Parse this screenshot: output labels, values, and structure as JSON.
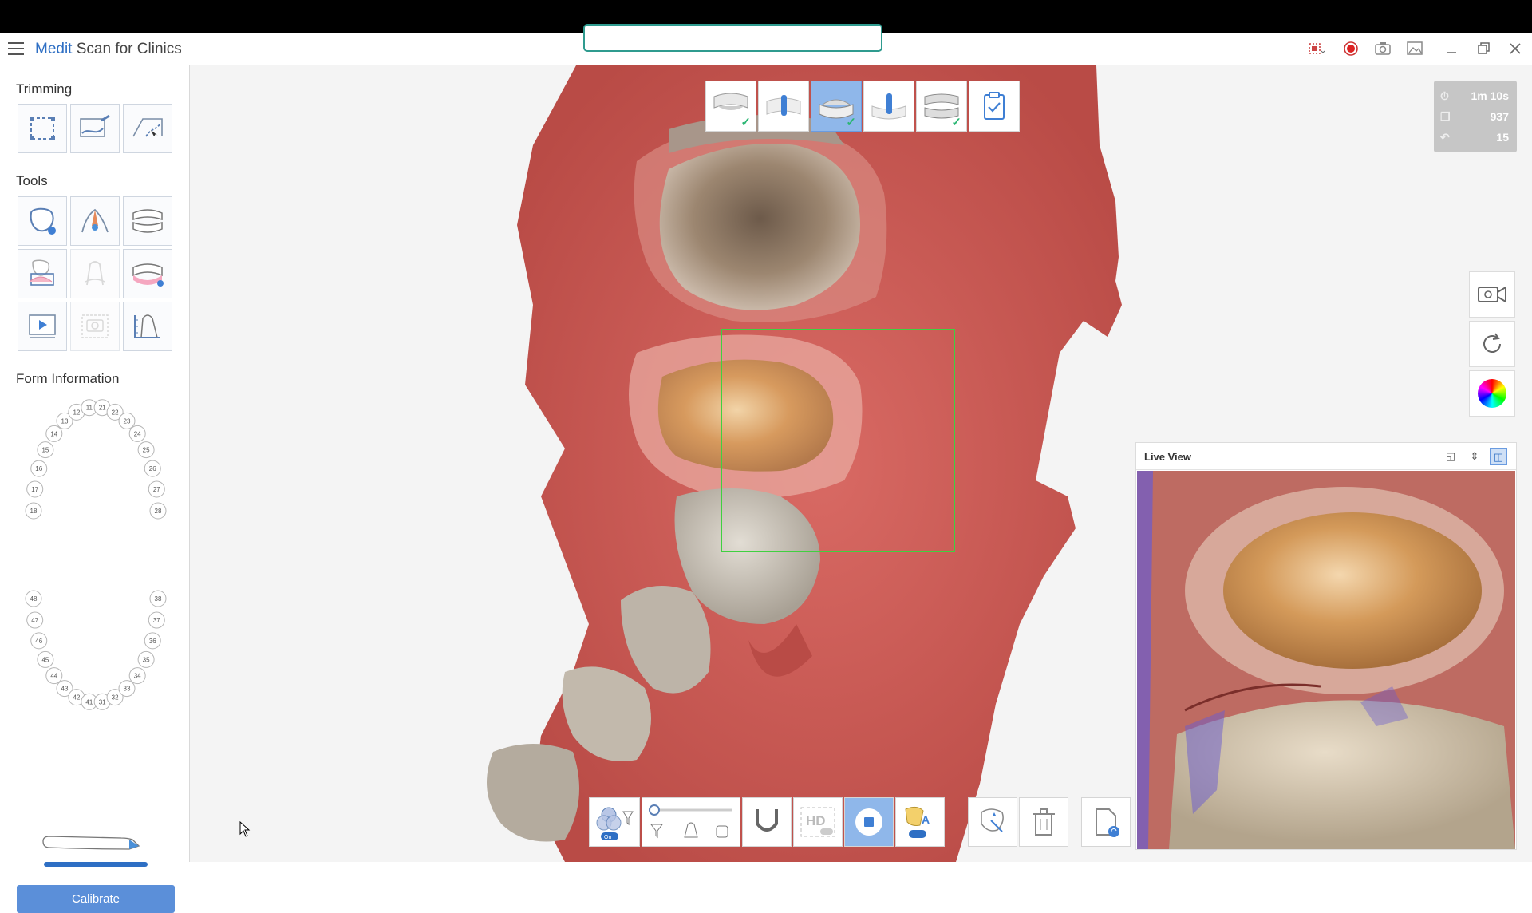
{
  "app": {
    "title_brand": "Medit",
    "title_rest": " Scan for Clinics"
  },
  "search": {
    "placeholder": ""
  },
  "sidebar": {
    "trimming_title": "Trimming",
    "trimming_tools": [
      "lasso-trim-icon",
      "brush-trim-icon",
      "plane-trim-icon"
    ],
    "tools_title": "Tools",
    "tools": [
      "lock-tooth-icon",
      "ai-filter-icon",
      "occlusion-icon",
      "gingiva-icon",
      "margin-icon",
      "arch-icon",
      "playback-icon",
      "capture-icon",
      "ruler-icon"
    ],
    "form_title": "Form Information",
    "upper_teeth": [
      "18",
      "17",
      "16",
      "15",
      "14",
      "13",
      "12",
      "11",
      "21",
      "22",
      "23",
      "24",
      "25",
      "26",
      "27",
      "28"
    ],
    "lower_teeth": [
      "48",
      "47",
      "46",
      "45",
      "44",
      "43",
      "42",
      "41",
      "31",
      "32",
      "33",
      "34",
      "35",
      "36",
      "37",
      "38"
    ],
    "calibrate_label": "Calibrate",
    "depth_level": 0.3
  },
  "stages": [
    {
      "name": "maxilla",
      "done": true
    },
    {
      "name": "maxilla-scanbody",
      "done": false
    },
    {
      "name": "mandible",
      "done": true,
      "active": true
    },
    {
      "name": "mandible-scanbody",
      "done": false
    },
    {
      "name": "occlusion",
      "done": true
    },
    {
      "name": "review",
      "done": false
    }
  ],
  "stats": {
    "time": "1m 10s",
    "frames": "937",
    "count": "15"
  },
  "live_view": {
    "title": "Live View"
  },
  "colors": {
    "accent": "#2e6fc4",
    "active_stage": "#8fb7ea",
    "check": "#2bb673",
    "scan_box": "#40d040"
  }
}
